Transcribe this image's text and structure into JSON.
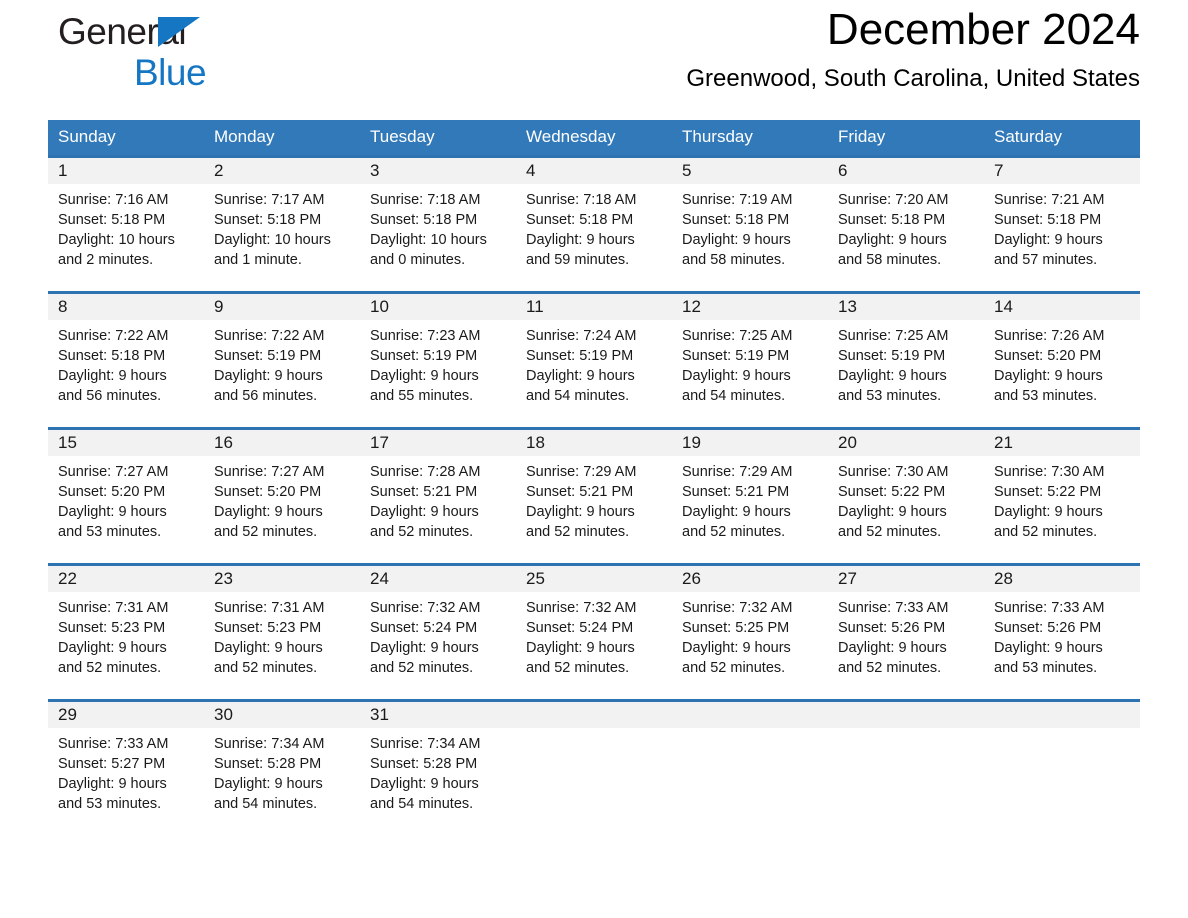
{
  "brand": {
    "word1": "General",
    "word2": "Blue",
    "triangle_color": "#1577c4",
    "text_color_1": "#231f20",
    "text_color_2": "#1577c4"
  },
  "header": {
    "month_title": "December 2024",
    "location": "Greenwood, South Carolina, United States"
  },
  "colors": {
    "header_blue": "#3179b9",
    "row_rule_blue": "#2e72b0",
    "daynum_band": "#f2f2f2"
  },
  "weekday_headers": [
    "Sunday",
    "Monday",
    "Tuesday",
    "Wednesday",
    "Thursday",
    "Friday",
    "Saturday"
  ],
  "weeks": [
    [
      {
        "day": "1",
        "sunrise": "Sunrise: 7:16 AM",
        "sunset": "Sunset: 5:18 PM",
        "daylight_line1": "Daylight: 10 hours",
        "daylight_line2": "and 2 minutes."
      },
      {
        "day": "2",
        "sunrise": "Sunrise: 7:17 AM",
        "sunset": "Sunset: 5:18 PM",
        "daylight_line1": "Daylight: 10 hours",
        "daylight_line2": "and 1 minute."
      },
      {
        "day": "3",
        "sunrise": "Sunrise: 7:18 AM",
        "sunset": "Sunset: 5:18 PM",
        "daylight_line1": "Daylight: 10 hours",
        "daylight_line2": "and 0 minutes."
      },
      {
        "day": "4",
        "sunrise": "Sunrise: 7:18 AM",
        "sunset": "Sunset: 5:18 PM",
        "daylight_line1": "Daylight: 9 hours",
        "daylight_line2": "and 59 minutes."
      },
      {
        "day": "5",
        "sunrise": "Sunrise: 7:19 AM",
        "sunset": "Sunset: 5:18 PM",
        "daylight_line1": "Daylight: 9 hours",
        "daylight_line2": "and 58 minutes."
      },
      {
        "day": "6",
        "sunrise": "Sunrise: 7:20 AM",
        "sunset": "Sunset: 5:18 PM",
        "daylight_line1": "Daylight: 9 hours",
        "daylight_line2": "and 58 minutes."
      },
      {
        "day": "7",
        "sunrise": "Sunrise: 7:21 AM",
        "sunset": "Sunset: 5:18 PM",
        "daylight_line1": "Daylight: 9 hours",
        "daylight_line2": "and 57 minutes."
      }
    ],
    [
      {
        "day": "8",
        "sunrise": "Sunrise: 7:22 AM",
        "sunset": "Sunset: 5:18 PM",
        "daylight_line1": "Daylight: 9 hours",
        "daylight_line2": "and 56 minutes."
      },
      {
        "day": "9",
        "sunrise": "Sunrise: 7:22 AM",
        "sunset": "Sunset: 5:19 PM",
        "daylight_line1": "Daylight: 9 hours",
        "daylight_line2": "and 56 minutes."
      },
      {
        "day": "10",
        "sunrise": "Sunrise: 7:23 AM",
        "sunset": "Sunset: 5:19 PM",
        "daylight_line1": "Daylight: 9 hours",
        "daylight_line2": "and 55 minutes."
      },
      {
        "day": "11",
        "sunrise": "Sunrise: 7:24 AM",
        "sunset": "Sunset: 5:19 PM",
        "daylight_line1": "Daylight: 9 hours",
        "daylight_line2": "and 54 minutes."
      },
      {
        "day": "12",
        "sunrise": "Sunrise: 7:25 AM",
        "sunset": "Sunset: 5:19 PM",
        "daylight_line1": "Daylight: 9 hours",
        "daylight_line2": "and 54 minutes."
      },
      {
        "day": "13",
        "sunrise": "Sunrise: 7:25 AM",
        "sunset": "Sunset: 5:19 PM",
        "daylight_line1": "Daylight: 9 hours",
        "daylight_line2": "and 53 minutes."
      },
      {
        "day": "14",
        "sunrise": "Sunrise: 7:26 AM",
        "sunset": "Sunset: 5:20 PM",
        "daylight_line1": "Daylight: 9 hours",
        "daylight_line2": "and 53 minutes."
      }
    ],
    [
      {
        "day": "15",
        "sunrise": "Sunrise: 7:27 AM",
        "sunset": "Sunset: 5:20 PM",
        "daylight_line1": "Daylight: 9 hours",
        "daylight_line2": "and 53 minutes."
      },
      {
        "day": "16",
        "sunrise": "Sunrise: 7:27 AM",
        "sunset": "Sunset: 5:20 PM",
        "daylight_line1": "Daylight: 9 hours",
        "daylight_line2": "and 52 minutes."
      },
      {
        "day": "17",
        "sunrise": "Sunrise: 7:28 AM",
        "sunset": "Sunset: 5:21 PM",
        "daylight_line1": "Daylight: 9 hours",
        "daylight_line2": "and 52 minutes."
      },
      {
        "day": "18",
        "sunrise": "Sunrise: 7:29 AM",
        "sunset": "Sunset: 5:21 PM",
        "daylight_line1": "Daylight: 9 hours",
        "daylight_line2": "and 52 minutes."
      },
      {
        "day": "19",
        "sunrise": "Sunrise: 7:29 AM",
        "sunset": "Sunset: 5:21 PM",
        "daylight_line1": "Daylight: 9 hours",
        "daylight_line2": "and 52 minutes."
      },
      {
        "day": "20",
        "sunrise": "Sunrise: 7:30 AM",
        "sunset": "Sunset: 5:22 PM",
        "daylight_line1": "Daylight: 9 hours",
        "daylight_line2": "and 52 minutes."
      },
      {
        "day": "21",
        "sunrise": "Sunrise: 7:30 AM",
        "sunset": "Sunset: 5:22 PM",
        "daylight_line1": "Daylight: 9 hours",
        "daylight_line2": "and 52 minutes."
      }
    ],
    [
      {
        "day": "22",
        "sunrise": "Sunrise: 7:31 AM",
        "sunset": "Sunset: 5:23 PM",
        "daylight_line1": "Daylight: 9 hours",
        "daylight_line2": "and 52 minutes."
      },
      {
        "day": "23",
        "sunrise": "Sunrise: 7:31 AM",
        "sunset": "Sunset: 5:23 PM",
        "daylight_line1": "Daylight: 9 hours",
        "daylight_line2": "and 52 minutes."
      },
      {
        "day": "24",
        "sunrise": "Sunrise: 7:32 AM",
        "sunset": "Sunset: 5:24 PM",
        "daylight_line1": "Daylight: 9 hours",
        "daylight_line2": "and 52 minutes."
      },
      {
        "day": "25",
        "sunrise": "Sunrise: 7:32 AM",
        "sunset": "Sunset: 5:24 PM",
        "daylight_line1": "Daylight: 9 hours",
        "daylight_line2": "and 52 minutes."
      },
      {
        "day": "26",
        "sunrise": "Sunrise: 7:32 AM",
        "sunset": "Sunset: 5:25 PM",
        "daylight_line1": "Daylight: 9 hours",
        "daylight_line2": "and 52 minutes."
      },
      {
        "day": "27",
        "sunrise": "Sunrise: 7:33 AM",
        "sunset": "Sunset: 5:26 PM",
        "daylight_line1": "Daylight: 9 hours",
        "daylight_line2": "and 52 minutes."
      },
      {
        "day": "28",
        "sunrise": "Sunrise: 7:33 AM",
        "sunset": "Sunset: 5:26 PM",
        "daylight_line1": "Daylight: 9 hours",
        "daylight_line2": "and 53 minutes."
      }
    ],
    [
      {
        "day": "29",
        "sunrise": "Sunrise: 7:33 AM",
        "sunset": "Sunset: 5:27 PM",
        "daylight_line1": "Daylight: 9 hours",
        "daylight_line2": "and 53 minutes."
      },
      {
        "day": "30",
        "sunrise": "Sunrise: 7:34 AM",
        "sunset": "Sunset: 5:28 PM",
        "daylight_line1": "Daylight: 9 hours",
        "daylight_line2": "and 54 minutes."
      },
      {
        "day": "31",
        "sunrise": "Sunrise: 7:34 AM",
        "sunset": "Sunset: 5:28 PM",
        "daylight_line1": "Daylight: 9 hours",
        "daylight_line2": "and 54 minutes."
      },
      {
        "day": "",
        "sunrise": "",
        "sunset": "",
        "daylight_line1": "",
        "daylight_line2": ""
      },
      {
        "day": "",
        "sunrise": "",
        "sunset": "",
        "daylight_line1": "",
        "daylight_line2": ""
      },
      {
        "day": "",
        "sunrise": "",
        "sunset": "",
        "daylight_line1": "",
        "daylight_line2": ""
      },
      {
        "day": "",
        "sunrise": "",
        "sunset": "",
        "daylight_line1": "",
        "daylight_line2": ""
      }
    ]
  ]
}
